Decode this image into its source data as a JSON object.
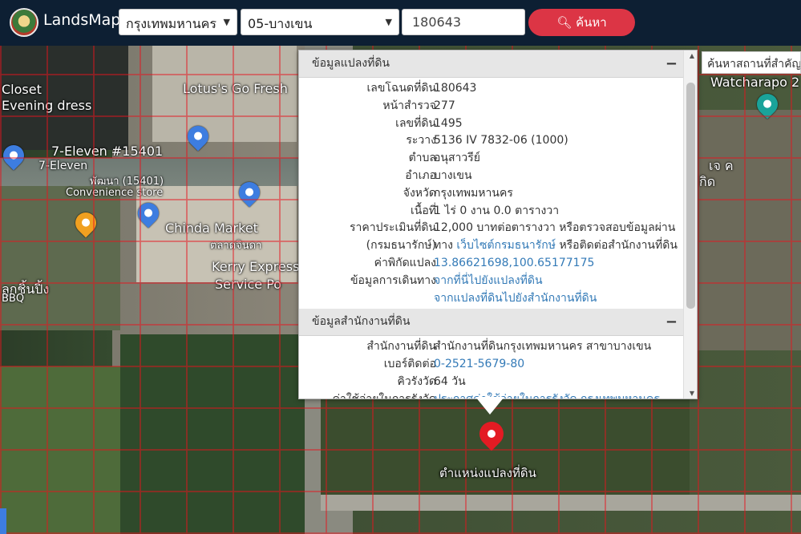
{
  "header": {
    "brand": "LandsMaps",
    "province_select": "กรุงเทพมหานคร",
    "district_select": "05-บางเขน",
    "search_value": "180643",
    "search_button": "ค้นหา"
  },
  "map": {
    "right_search_placeholder": "ค้นหาสถานที่สำคัญ",
    "labels": [
      "Closet",
      "Evening dress",
      "Lotus's Go Fresh",
      "7-Eleven #15401",
      "7-Eleven",
      "พัฒนา (15401)",
      "Convenience store",
      "Chinda Market",
      "ตลาดจินดา",
      "Kerry Express",
      "Service Po",
      "ลูกชิ้นปิ้ง",
      "BBQ",
      "Watcharapo 2",
      "เจ ค",
      "กิด"
    ],
    "pin_label": "ตำแหน่งแปลงที่ดิน"
  },
  "popup": {
    "section1": {
      "title": "ข้อมูลแปลงที่ดิน",
      "collapse": "−",
      "rows": [
        {
          "label": "เลขโฉนดที่ดิน",
          "value": "180643"
        },
        {
          "label": "หน้าสำรวจ",
          "value": "277"
        },
        {
          "label": "เลขที่ดิน",
          "value": "1495"
        },
        {
          "label": "ระวาง",
          "value": "5136 IV 7832-06 (1000)"
        },
        {
          "label": "ตำบล",
          "value": "อนุสาวรีย์"
        },
        {
          "label": "อำเภอ",
          "value": "บางเขน"
        },
        {
          "label": "จังหวัด",
          "value": "กรุงเทพมหานคร"
        },
        {
          "label": "เนื้อที่",
          "value": "1 ไร่ 0 งาน 0.0 ตารางวา"
        },
        {
          "label": "ราคาประเมินที่ดิน",
          "value": "12,000 บาทต่อตารางวา หรือตรวจสอบข้อมูลผ่าน"
        },
        {
          "label": "(กรมธนารักษ์)",
          "value_prefix": "ทาง",
          "value_link": "เว็บไซต์กรมธนารักษ์",
          "value_suffix": "หรือติดต่อสำนักงานที่ดิน"
        },
        {
          "label": "ค่าพิกัดแปลง",
          "value": "13.86621698,100.65177175"
        },
        {
          "label": "ข้อมูลการเดินทาง",
          "value": "จากที่นี่ไปยังแปลงที่ดิน"
        },
        {
          "label": "",
          "value": "จากแปลงที่ดินไปยังสำนักงานที่ดิน"
        }
      ]
    },
    "section2": {
      "title": "ข้อมูลสำนักงานที่ดิน",
      "collapse": "−",
      "rows": [
        {
          "label": "สำนักงานที่ดิน",
          "value": "สำนักงานที่ดินกรุงเทพมหานคร สาขาบางเขน"
        },
        {
          "label": "เบอร์ติดต่อ",
          "value": "0-2521-5679-80"
        },
        {
          "label": "คิวรังวัด",
          "value": "64 วัน"
        },
        {
          "label": "ค่าใช้จ่ายในการรังวัด",
          "value": "ประกาศค่าใช้จ่ายในการรังวัด กรุงเทพมหานคร"
        }
      ]
    }
  },
  "colors": {
    "topbar": "#0d1f33",
    "search_button": "#dc3545",
    "link": "#337ab7",
    "pin": "#e31b23"
  }
}
